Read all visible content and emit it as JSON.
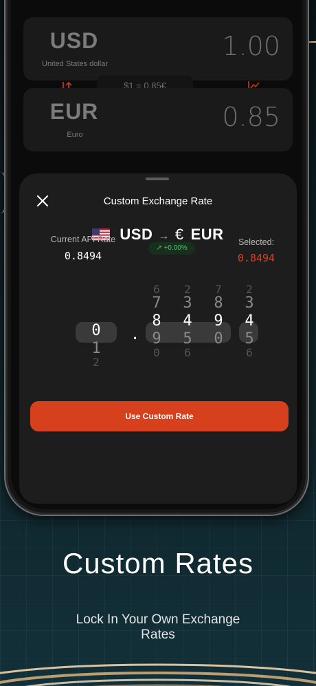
{
  "top": {
    "from": {
      "code": "USD",
      "name": "United States dollar",
      "value": "1.00"
    },
    "to": {
      "code": "EUR",
      "name": "Euro",
      "value": "0.85"
    },
    "rate_pill": "$1 = 0.85€"
  },
  "sheet": {
    "title": "Custom Exchange Rate",
    "pair": {
      "from": "USD",
      "arrow": "→",
      "to_symbol": "€",
      "to": "EUR"
    },
    "api": {
      "label": "Current API Rate",
      "value": "0.8494"
    },
    "change": "↗ +0.00%",
    "selected": {
      "label": "Selected:",
      "value": "0.8494"
    },
    "picker": {
      "whole": {
        "above": "",
        "value": "0",
        "below": "1",
        "below2": "2"
      },
      "separator": ".",
      "d1": {
        "above2": "6",
        "above": "7",
        "value": "8",
        "below": "9",
        "below2": "0"
      },
      "d2": {
        "above2": "2",
        "above": "3",
        "value": "4",
        "below": "5",
        "below2": "6"
      },
      "d3": {
        "above2": "7",
        "above": "8",
        "value": "9",
        "below": "0",
        "below2": ""
      },
      "d4": {
        "above2": "2",
        "above": "3",
        "value": "4",
        "below": "5",
        "below2": "6"
      }
    },
    "cta": "Use Custom Rate"
  },
  "headline": "Custom Rates",
  "subline": "Lock In Your Own Exchange Rates",
  "colors": {
    "accent": "#d7401c",
    "positive": "#4cc56a",
    "arrow_red": "#d7401c"
  }
}
